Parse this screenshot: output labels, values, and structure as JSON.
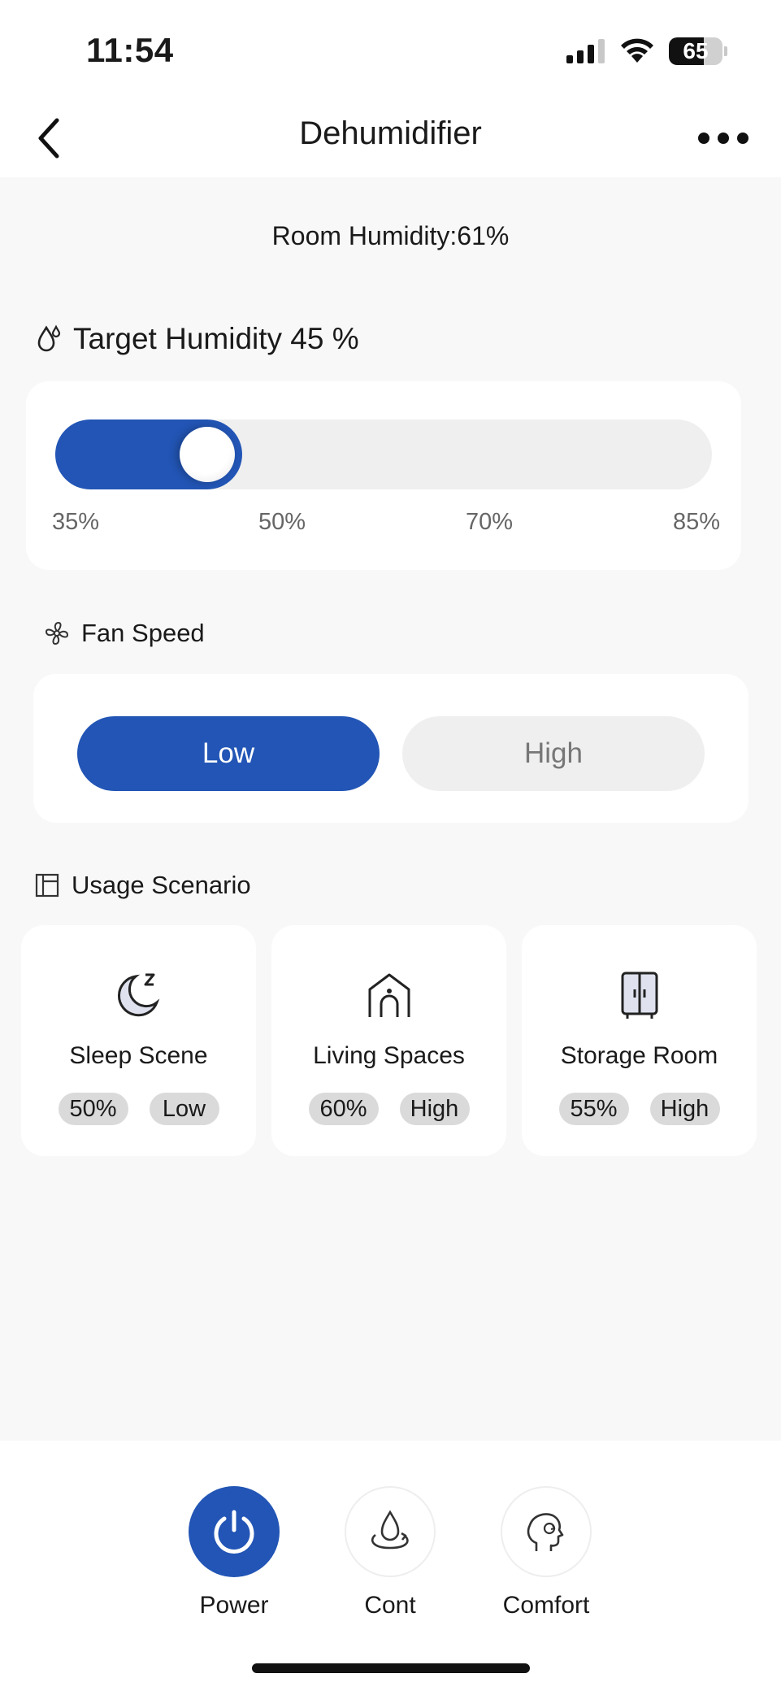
{
  "status": {
    "time": "11:54",
    "battery": "65",
    "battery_level": 0.65
  },
  "nav": {
    "title": "Dehumidifier"
  },
  "room_humidity": "Room Humidity:61%",
  "target": {
    "label": "Target Humidity 45 %",
    "value": 45,
    "min": 35,
    "max": 85
  },
  "slider_ticks": [
    "35%",
    "50%",
    "70%",
    "85%"
  ],
  "fan": {
    "label": "Fan Speed",
    "low": "Low",
    "high": "High",
    "selected": "Low"
  },
  "usage": {
    "label": "Usage Scenario",
    "scenes": [
      {
        "name": "Sleep Scene",
        "humidity": "50%",
        "speed": "Low",
        "icon": "moon-sleep-icon"
      },
      {
        "name": "Living Spaces",
        "humidity": "60%",
        "speed": "High",
        "icon": "house-icon"
      },
      {
        "name": "Storage Room",
        "humidity": "55%",
        "speed": "High",
        "icon": "wardrobe-icon"
      }
    ]
  },
  "actions": [
    {
      "label": "Power",
      "icon": "power-icon",
      "active": true
    },
    {
      "label": "Cont",
      "icon": "water-drop-cycle-icon",
      "active": false
    },
    {
      "label": "Comfort",
      "icon": "head-comfort-icon",
      "active": false
    }
  ],
  "colors": {
    "accent": "#2255b5",
    "track": "#efefef",
    "background": "#f8f8f8"
  }
}
